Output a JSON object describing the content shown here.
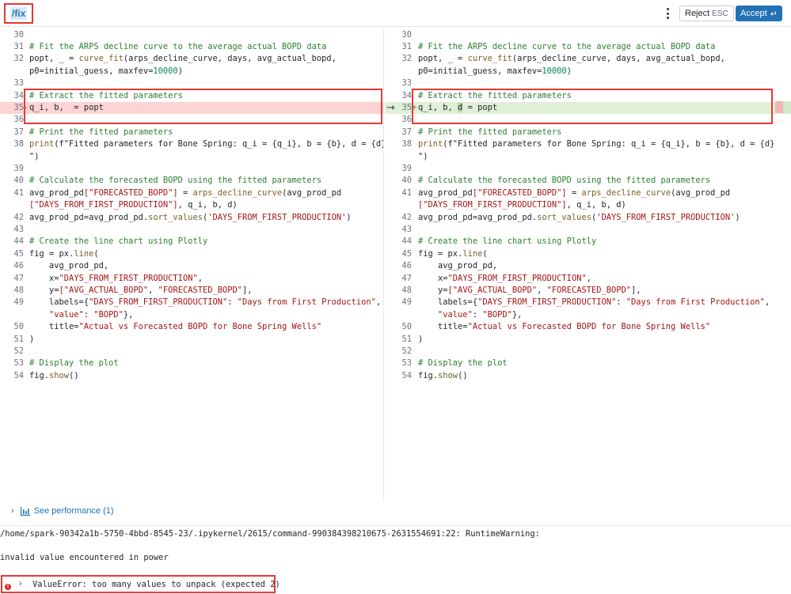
{
  "header": {
    "command": "/fix",
    "reject_label": "Reject",
    "reject_key": "ESC",
    "accept_label": "Accept",
    "accept_key": "↵"
  },
  "diff": {
    "arrow": "→",
    "left": [
      {
        "n": "30",
        "code": ""
      },
      {
        "n": "31",
        "code": "# Fit the ARPS decline curve to the average actual BOPD data"
      },
      {
        "n": "32",
        "code": "popt, _ = curve_fit(arps_decline_curve, days, avg_actual_bopd,"
      },
      {
        "n": "",
        "code": "p0=initial_guess, maxfev=10000)"
      },
      {
        "n": "33",
        "code": ""
      },
      {
        "n": "34",
        "code": "# Extract the fitted parameters"
      },
      {
        "n": "35",
        "code": "q_i, b,  = popt",
        "type": "del"
      },
      {
        "n": "36",
        "code": ""
      },
      {
        "n": "37",
        "code": "# Print the fitted parameters"
      },
      {
        "n": "38",
        "code": "print(f\"Fitted parameters for Bone Spring: q_i = {q_i}, b = {b}, d = {d}"
      },
      {
        "n": "",
        "code": "\")"
      },
      {
        "n": "39",
        "code": ""
      },
      {
        "n": "40",
        "code": "# Calculate the forecasted BOPD using the fitted parameters"
      },
      {
        "n": "41",
        "code": "avg_prod_pd[\"FORECASTED_BOPD\"] = arps_decline_curve(avg_prod_pd"
      },
      {
        "n": "",
        "code": "[\"DAYS_FROM_FIRST_PRODUCTION\"], q_i, b, d)"
      },
      {
        "n": "42",
        "code": "avg_prod_pd=avg_prod_pd.sort_values('DAYS_FROM_FIRST_PRODUCTION')"
      },
      {
        "n": "43",
        "code": ""
      },
      {
        "n": "44",
        "code": "# Create the line chart using Plotly"
      },
      {
        "n": "45",
        "code": "fig = px.line("
      },
      {
        "n": "46",
        "code": "    avg_prod_pd,"
      },
      {
        "n": "47",
        "code": "    x=\"DAYS_FROM_FIRST_PRODUCTION\","
      },
      {
        "n": "48",
        "code": "    y=[\"AVG_ACTUAL_BOPD\", \"FORECASTED_BOPD\"],"
      },
      {
        "n": "49",
        "code": "    labels={\"DAYS_FROM_FIRST_PRODUCTION\": \"Days from First Production\","
      },
      {
        "n": "",
        "code": "    \"value\": \"BOPD\"},"
      },
      {
        "n": "50",
        "code": "    title=\"Actual vs Forecasted BOPD for Bone Spring Wells\""
      },
      {
        "n": "51",
        "code": ")"
      },
      {
        "n": "52",
        "code": ""
      },
      {
        "n": "53",
        "code": "# Display the plot"
      },
      {
        "n": "54",
        "code": "fig.show()"
      }
    ],
    "right": [
      {
        "n": "30",
        "code": ""
      },
      {
        "n": "31",
        "code": "# Fit the ARPS decline curve to the average actual BOPD data"
      },
      {
        "n": "32",
        "code": "popt, _ = curve_fit(arps_decline_curve, days, avg_actual_bopd,"
      },
      {
        "n": "",
        "code": "p0=initial_guess, maxfev=10000)"
      },
      {
        "n": "33",
        "code": ""
      },
      {
        "n": "34",
        "code": "# Extract the fitted parameters"
      },
      {
        "n": "35",
        "code": "q_i, b, d = popt",
        "type": "ins"
      },
      {
        "n": "36",
        "code": ""
      },
      {
        "n": "37",
        "code": "# Print the fitted parameters"
      },
      {
        "n": "38",
        "code": "print(f\"Fitted parameters for Bone Spring: q_i = {q_i}, b = {b}, d = {d}"
      },
      {
        "n": "",
        "code": "\")"
      },
      {
        "n": "39",
        "code": ""
      },
      {
        "n": "40",
        "code": "# Calculate the forecasted BOPD using the fitted parameters"
      },
      {
        "n": "41",
        "code": "avg_prod_pd[\"FORECASTED_BOPD\"] = arps_decline_curve(avg_prod_pd"
      },
      {
        "n": "",
        "code": "[\"DAYS_FROM_FIRST_PRODUCTION\"], q_i, b, d)"
      },
      {
        "n": "42",
        "code": "avg_prod_pd=avg_prod_pd.sort_values('DAYS_FROM_FIRST_PRODUCTION')"
      },
      {
        "n": "43",
        "code": ""
      },
      {
        "n": "44",
        "code": "# Create the line chart using Plotly"
      },
      {
        "n": "45",
        "code": "fig = px.line("
      },
      {
        "n": "46",
        "code": "    avg_prod_pd,"
      },
      {
        "n": "47",
        "code": "    x=\"DAYS_FROM_FIRST_PRODUCTION\","
      },
      {
        "n": "48",
        "code": "    y=[\"AVG_ACTUAL_BOPD\", \"FORECASTED_BOPD\"],"
      },
      {
        "n": "49",
        "code": "    labels={\"DAYS_FROM_FIRST_PRODUCTION\": \"Days from First Production\","
      },
      {
        "n": "",
        "code": "    \"value\": \"BOPD\"},"
      },
      {
        "n": "50",
        "code": "    title=\"Actual vs Forecasted BOPD for Bone Spring Wells\""
      },
      {
        "n": "51",
        "code": ")"
      },
      {
        "n": "52",
        "code": ""
      },
      {
        "n": "53",
        "code": "# Display the plot"
      },
      {
        "n": "54",
        "code": "fig.show()"
      }
    ]
  },
  "performance": {
    "label": "See performance (1)"
  },
  "output": {
    "warning_path": "/home/spark-90342a1b-5750-4bbd-8545-23/.ipykernel/2615/command-990384398210675-2631554691:22: RuntimeWarning:",
    "warning_msg": "invalid value encountered in power",
    "error_icon": "!",
    "error_text": "ValueError: too many values to unpack (expected 2)"
  },
  "colors": {
    "accent": "#2272b4",
    "deletion": "#fcd4d4",
    "insertion": "#dff0d6",
    "annotation_box": "#e53935",
    "error": "#d32f2f"
  },
  "icons": {
    "menu": "kebab-menu-icon",
    "enter": "enter-key-icon",
    "chart": "bar-chart-icon",
    "expand": "chevron-right-icon",
    "error": "error-circle-icon",
    "diff_arrow": "arrow-right-icon"
  }
}
